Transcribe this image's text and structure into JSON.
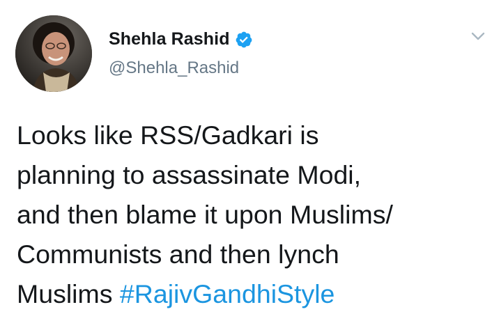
{
  "tweet": {
    "author": {
      "display_name": "Shehla Rashid",
      "handle": "@Shehla_Rashid",
      "verified": true,
      "avatar_icon": "profile-photo"
    },
    "menu_icon": "chevron-down-icon",
    "text_lines": [
      "Looks like RSS/Gadkari is",
      "planning to assassinate Modi,",
      "and then blame it upon Muslims/",
      "Communists and then lynch",
      "Muslims "
    ],
    "hashtag": "#RajivGandhiStyle"
  },
  "colors": {
    "name": "#14171a",
    "handle": "#657786",
    "hashtag": "#1b95e0",
    "verified_badge": "#1da1f2",
    "caret": "#aab8c2"
  }
}
